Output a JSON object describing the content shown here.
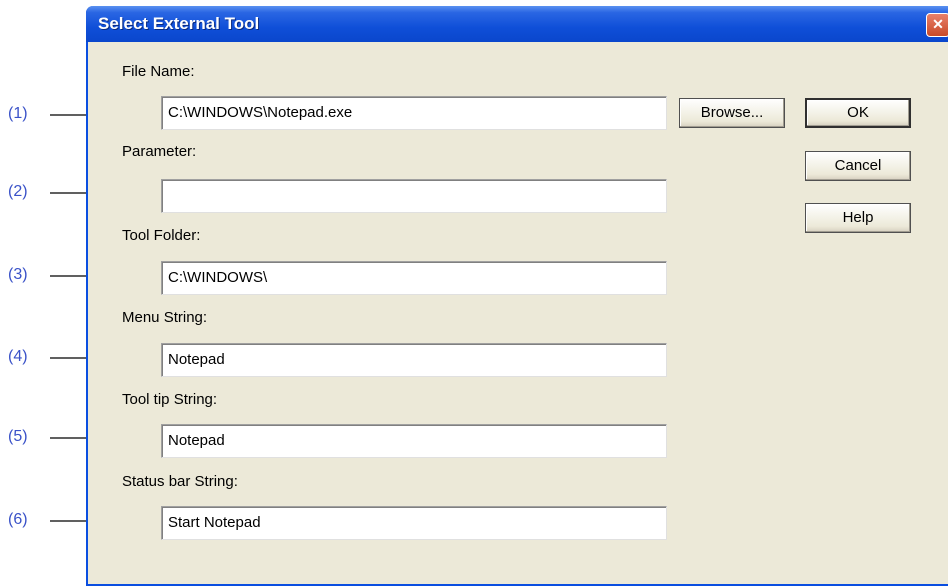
{
  "callouts": [
    "(1)",
    "(2)",
    "(3)",
    "(4)",
    "(5)",
    "(6)"
  ],
  "dialog": {
    "title": "Select External Tool",
    "close_glyph": "✕",
    "fields": {
      "file_name": {
        "label": "File Name:",
        "value": "C:\\WINDOWS\\Notepad.exe"
      },
      "parameter": {
        "label": "Parameter:",
        "value": ""
      },
      "tool_folder": {
        "label": "Tool Folder:",
        "value": "C:\\WINDOWS\\"
      },
      "menu_string": {
        "label": "Menu String:",
        "value": "Notepad"
      },
      "tooltip_string": {
        "label": "Tool tip String:",
        "value": "Notepad"
      },
      "status_bar_string": {
        "label": "Status bar String:",
        "value": "Start Notepad"
      }
    },
    "buttons": {
      "browse": "Browse...",
      "ok": "OK",
      "cancel": "Cancel",
      "help": "Help"
    }
  },
  "colors": {
    "callout_text": "#3a52c8",
    "titlebar": "#0a46cc",
    "dialog_bg": "#ece9d8"
  }
}
